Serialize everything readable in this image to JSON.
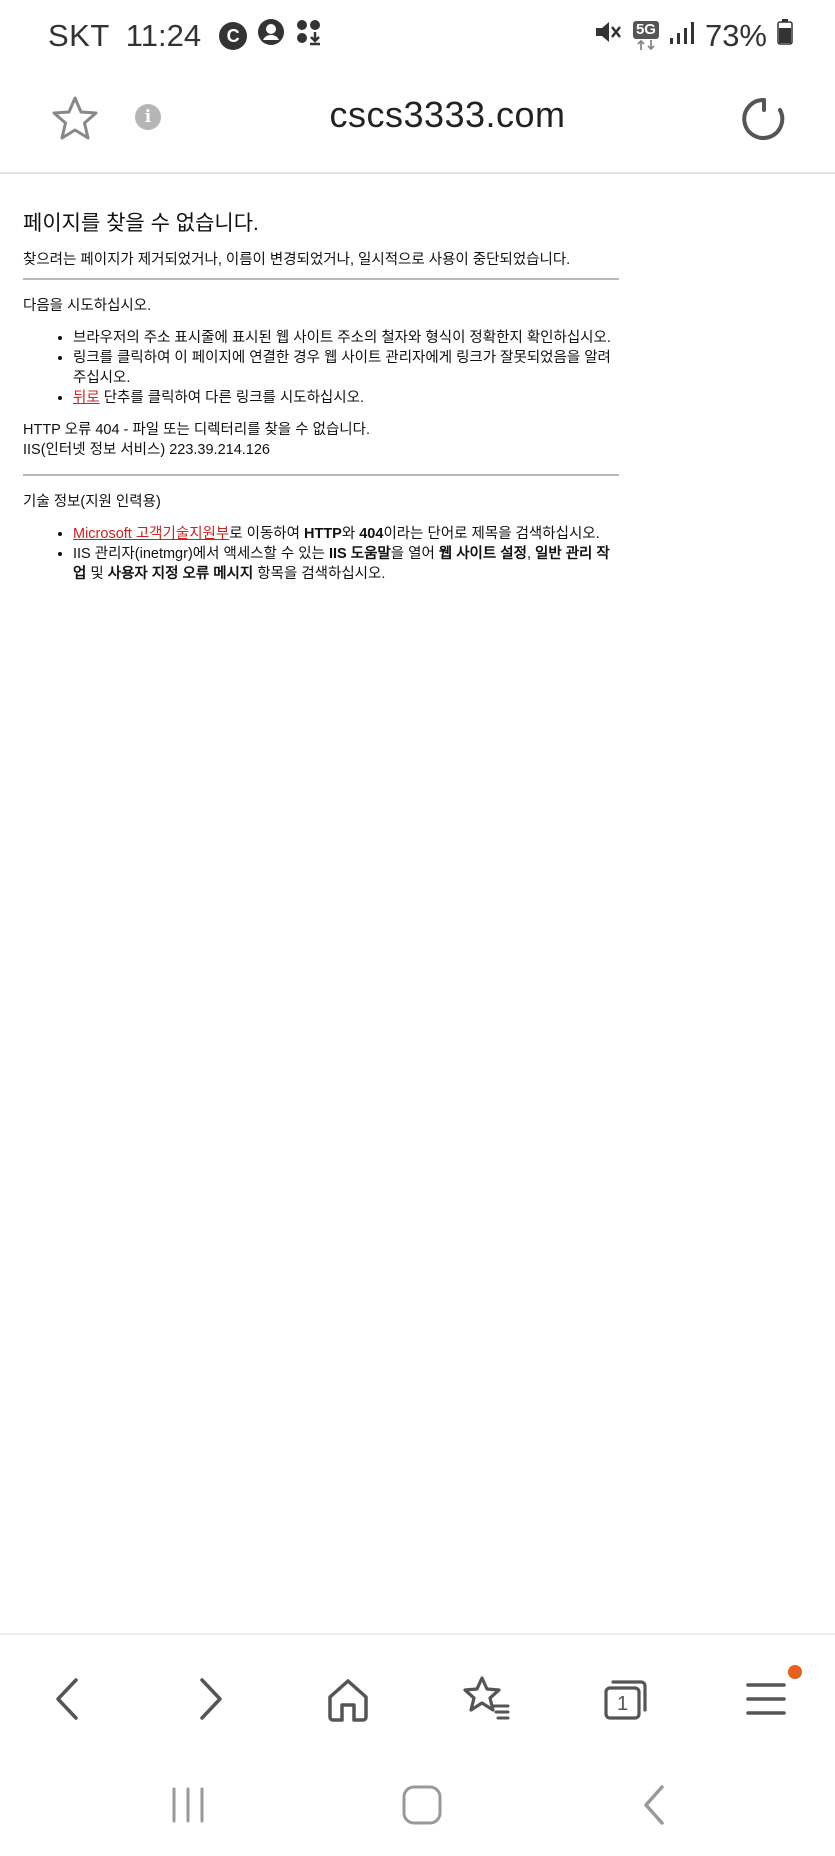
{
  "status_bar": {
    "carrier": "SKT",
    "time": "11:24",
    "left_icons": [
      "copyright-c-icon",
      "account-icon",
      "download-icon"
    ],
    "network": "5G",
    "battery": "73%"
  },
  "toolbar": {
    "url": "cscs3333.com",
    "info_glyph": "i"
  },
  "page": {
    "title": "페이지를 찾을 수 없습니다.",
    "subtitle": "찾으려는 페이지가 제거되었거나, 이름이 변경되었거나, 일시적으로 사용이 중단되었습니다.",
    "try_heading": "다음을 시도하십시오.",
    "try_item1": "브라우저의 주소 표시줄에 표시된 웹 사이트 주소의 철자와 형식이 정확한지 확인하십시오.",
    "try_item2": "링크를 클릭하여 이 페이지에 연결한 경우 웹 사이트 관리자에게 링크가 잘못되었음을 알려 주십시오.",
    "try_item3_link": "뒤로",
    "try_item3_rest": " 단추를 클릭하여 다른 링크를 시도하십시오.",
    "error_line": "HTTP 오류 404 - 파일 또는 디렉터리를 찾을 수 없습니다.",
    "server_line": "IIS(인터넷 정보 서비스) 223.39.214.126",
    "tech_heading": "기술 정보(지원 인력용)",
    "tech_item1_link": "Microsoft 고객기술지원부",
    "tech_item1_a": "로 이동하여 ",
    "tech_item1_b1": "HTTP",
    "tech_item1_c": "와 ",
    "tech_item1_b2": "404",
    "tech_item1_d": "이라는 단어로 제목을 검색하십시오.",
    "tech_item2_a": "IIS 관리자(inetmgr)에서 액세스할 수 있는 ",
    "tech_item2_b1": "IIS 도움말",
    "tech_item2_c": "을 열어 ",
    "tech_item2_b2": "웹 사이트 설정",
    "tech_item2_d": ", ",
    "tech_item2_b3": "일반 관리 작업",
    "tech_item2_e": " 및 ",
    "tech_item2_b4": "사용자 지정 오류 메시지",
    "tech_item2_f": " 항목을 검색하십시오."
  },
  "bottom_nav": {
    "tab_count": "1",
    "buttons": [
      "back-icon",
      "forward-icon",
      "home-icon",
      "bookmarks-icon",
      "tabs-icon",
      "menu-icon"
    ]
  },
  "colors": {
    "link": "#d32020",
    "notification_dot": "#e8601c",
    "divider": "#b8b8b8"
  }
}
